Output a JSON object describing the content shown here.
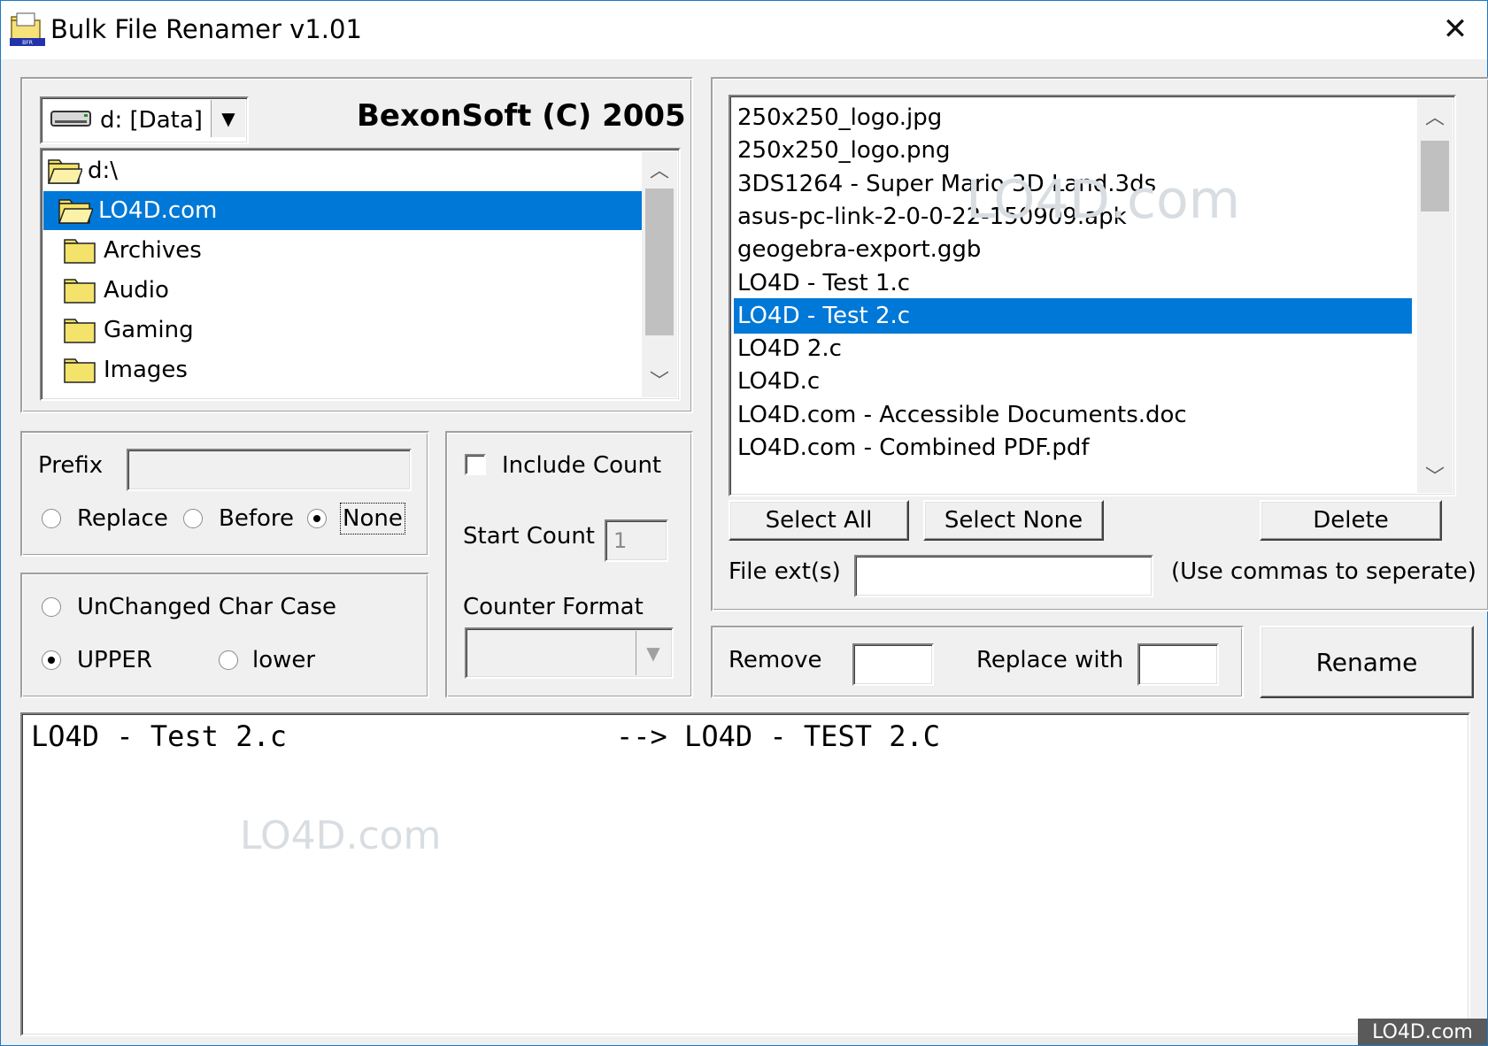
{
  "window": {
    "title": "Bulk File Renamer v1.01",
    "close_glyph": "✕"
  },
  "drive": {
    "value": "d: [Data]",
    "arrow": "▼"
  },
  "brand": "BexonSoft (C) 2005",
  "directories": [
    {
      "label": "d:\\",
      "selected": false,
      "icon": "open-folder-icon"
    },
    {
      "label": "LO4D.com",
      "selected": true,
      "icon": "open-folder-icon"
    },
    {
      "label": "Archives",
      "selected": false,
      "icon": "folder-icon"
    },
    {
      "label": "Audio",
      "selected": false,
      "icon": "folder-icon"
    },
    {
      "label": "Gaming",
      "selected": false,
      "icon": "folder-icon"
    },
    {
      "label": "Images",
      "selected": false,
      "icon": "folder-icon"
    }
  ],
  "files": [
    {
      "name": "250x250_logo.jpg",
      "selected": false
    },
    {
      "name": "250x250_logo.png",
      "selected": false
    },
    {
      "name": "3DS1264 - Super Mario 3D Land.3ds",
      "selected": false
    },
    {
      "name": "asus-pc-link-2-0-0-22-150909.apk",
      "selected": false
    },
    {
      "name": "geogebra-export.ggb",
      "selected": false
    },
    {
      "name": "LO4D - Test 1.c",
      "selected": false
    },
    {
      "name": "LO4D - Test 2.c",
      "selected": true
    },
    {
      "name": "LO4D 2.c",
      "selected": false
    },
    {
      "name": "LO4D.c",
      "selected": false
    },
    {
      "name": "LO4D.com - Accessible Documents.doc",
      "selected": false
    },
    {
      "name": "LO4D.com - Combined PDF.pdf",
      "selected": false
    }
  ],
  "scroll": {
    "up": "︿",
    "down": "﹀"
  },
  "prefix": {
    "label": "Prefix",
    "value": "",
    "options": [
      {
        "label": "Replace",
        "checked": false
      },
      {
        "label": "Before",
        "checked": false
      },
      {
        "label": "None",
        "checked": true
      }
    ]
  },
  "counter": {
    "include_label": "Include Count",
    "include_checked": false,
    "start_label": "Start Count",
    "start_value": "1",
    "format_label": "Counter Format",
    "format_value": ""
  },
  "char_case": {
    "unchanged_label": "UnChanged Char Case",
    "upper_label": "UPPER",
    "lower_label": "lower",
    "selected": "UPPER"
  },
  "buttons": {
    "select_all": "Select All",
    "select_none": "Select None",
    "delete": "Delete",
    "rename": "Rename"
  },
  "file_ext": {
    "label": "File ext(s)",
    "value": "",
    "hint": "(Use commas to seperate)"
  },
  "replace": {
    "remove_label": "Remove",
    "remove_value": "",
    "with_label": "Replace with",
    "with_value": ""
  },
  "preview": {
    "original": "LO4D - Test 2.c",
    "arrow": "-->",
    "renamed": "LO4D - TEST 2.C"
  },
  "watermark": "LO4D.com",
  "corner_badge": "LO4D.com",
  "colors": {
    "selection": "#0078d7",
    "window_border": "#1979ca",
    "face": "#f0f0f0"
  }
}
